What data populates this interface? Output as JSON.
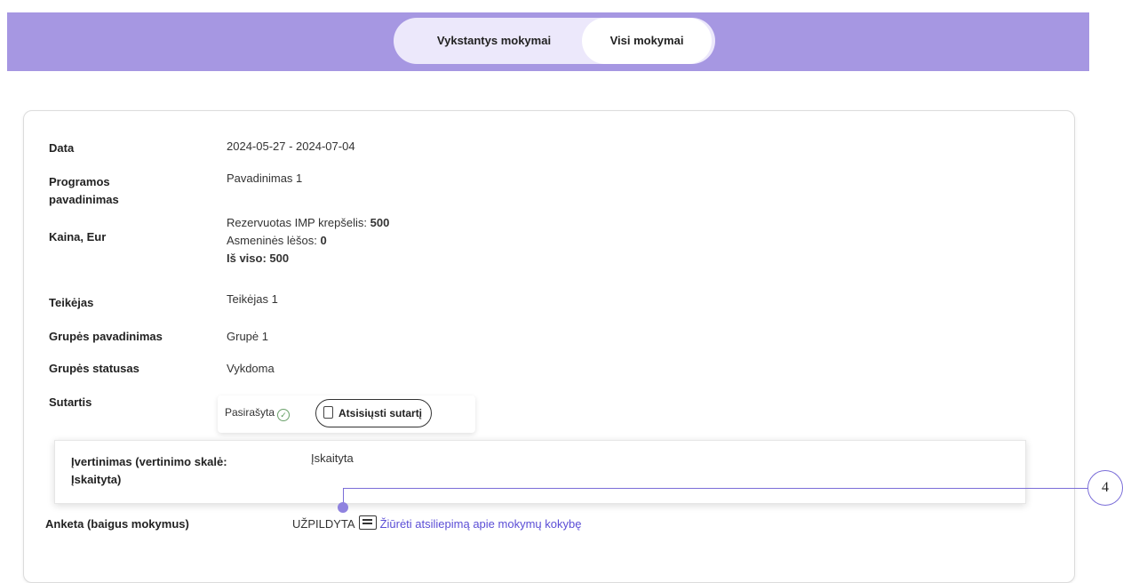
{
  "tabs": [
    {
      "label": "Vykstantys mokymai",
      "active": false
    },
    {
      "label": "Visi mokymai",
      "active": true
    }
  ],
  "details": {
    "date_label": "Data",
    "date_value": "2024-05-27 - 2024-07-04",
    "program_label_1": "Programos",
    "program_label_2": "pavadinimas",
    "program_value": "Pavadinimas 1",
    "price_label": "Kaina, Eur",
    "price_reserved_label": "Rezervuotas IMP krepšelis: ",
    "price_reserved_value": "500",
    "price_personal_label": "Asmeninės lėšos: ",
    "price_personal_value": "0",
    "price_total": "Iš viso: 500",
    "provider_label": "Teikėjas",
    "provider_value": "Teikėjas 1",
    "group_name_label": "Grupės pavadinimas",
    "group_name_value": "Grupė 1",
    "group_status_label": "Grupės statusas",
    "group_status_value": "Vykdoma",
    "contract_label": "Sutartis",
    "contract_status": "Pasirašyta",
    "contract_download": "Atsisiųsti sutartį",
    "evaluation_label_1": "Įvertinimas (vertinimo skalė:",
    "evaluation_label_2": "Įskaityta)",
    "evaluation_value": "Įskaityta",
    "survey_label": "Anketa (baigus mokymus)",
    "survey_status": "UŽPILDYTA",
    "survey_link": "Žiūrėti atsiliepimą apie mokymų kokybę"
  },
  "callout": {
    "number": "4"
  },
  "colors": {
    "header": "#a697e2",
    "accent": "#5b4ed6",
    "callout": "#7a6dd8"
  },
  "icons": [
    "check-circle-icon",
    "document-icon",
    "form-icon"
  ]
}
